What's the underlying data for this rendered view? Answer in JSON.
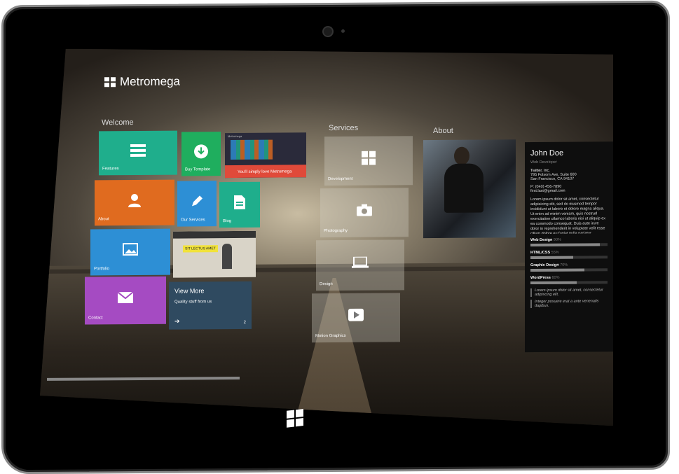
{
  "app": {
    "name": "Metromega"
  },
  "sections": {
    "welcome": "Welcome",
    "services": "Services",
    "about": "About"
  },
  "tiles": {
    "features": {
      "label": "Features",
      "color": "#1fae8c",
      "icon": "list-icon"
    },
    "buy_template": {
      "label": "Buy Template",
      "color": "#1fae5e",
      "icon": "download-icon"
    },
    "promo": {
      "label": "You'll simply love Metromega",
      "color": "#e04a3a"
    },
    "about": {
      "label": "About",
      "color": "#e06b1f",
      "icon": "user-icon"
    },
    "our_services": {
      "label": "Our Services",
      "color": "#2d8fd5",
      "icon": "pencil-icon"
    },
    "blog": {
      "label": "Blog",
      "color": "#1fae8c",
      "icon": "document-icon"
    },
    "portfolio": {
      "label": "Portfolio",
      "color": "#2d8fd5",
      "icon": "image-icon"
    },
    "contact": {
      "label": "Contact",
      "color": "#a54bc2",
      "icon": "mail-icon"
    },
    "view_more": {
      "title": "View More",
      "subtitle": "Quality stuff from us",
      "count": "2",
      "color": "#2f4a60"
    }
  },
  "services": [
    {
      "label": "Development",
      "icon": "windows-icon"
    },
    {
      "label": "Photography",
      "icon": "camera-icon"
    },
    {
      "label": "Design",
      "icon": "laptop-icon"
    },
    {
      "label": "Motion Graphics",
      "icon": "play-icon"
    }
  ],
  "profile": {
    "name": "John Doe",
    "role": "Web Developer",
    "company": "Twitter, Inc.",
    "address1": "795 Folsom Ave, Suite 600",
    "address2": "San Francisco, CA 94107",
    "phone": "P: (040) 456-7890",
    "email": "first.last@gmail.com",
    "bio": "Lorem ipsum dolor sit amet, consectetur adipisicing elit, sed do eiusmod tempor incididunt ut labore et dolore magna aliqua. Ut enim ad minim veniam, quis nostrud exercitation ullamco laboris nisi ut aliquip ex ea commodo consequat. Duis aute irure dolor in reprehenderit in voluptate velit esse cillum dolore eu fugiat nulla pariatur. Excepteur sint occaecat cupidatat non proident, sunt in culpa qui officia deserunt mollit anim id est laborum.",
    "skills": [
      {
        "name": "Web Design",
        "pct": "90%",
        "value": 0.9
      },
      {
        "name": "HTML/CSS",
        "pct": "55%",
        "value": 0.55
      },
      {
        "name": "Graphic Design",
        "pct": "70%",
        "value": 0.7
      },
      {
        "name": "WordPress",
        "pct": "60%",
        "value": 0.6
      }
    ],
    "quote1": "Lorem ipsum dolor sit amet, consectetur adipiscing elit.",
    "quote2": "Integer posuere erat a ante venenatis dapibus."
  },
  "mini_screens": {
    "promo_title": "Metromega",
    "portfolio_banner": "SIT LECTUS AMET"
  }
}
